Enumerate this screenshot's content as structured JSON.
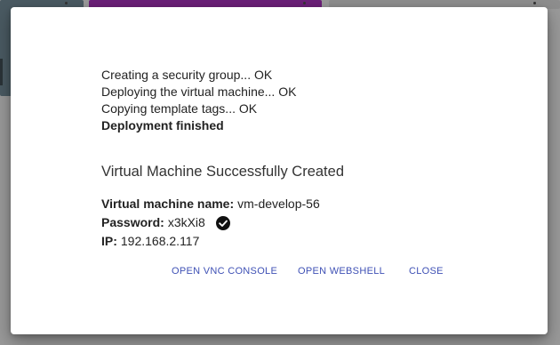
{
  "log": {
    "lines": [
      "Creating a security group... OK",
      "Deploying the virtual machine... OK",
      "Copying template tags... OK"
    ],
    "finished": "Deployment finished"
  },
  "success_title": "Virtual Machine Successfully Created",
  "details": {
    "name_label": "Virtual machine name:",
    "name_value": "vm-develop-56",
    "password_label": "Password:",
    "password_value": "x3kXi8",
    "password_icon": "check-circle-icon",
    "ip_label": "IP:",
    "ip_value": "192.168.2.117"
  },
  "actions": {
    "vnc_label": "OPEN VNC CONSOLE",
    "webshell_label": "OPEN WEBSHELL",
    "close_label": "CLOSE"
  },
  "colors": {
    "accent": "#3f51b5",
    "backdrop": "#9a9a9a"
  }
}
